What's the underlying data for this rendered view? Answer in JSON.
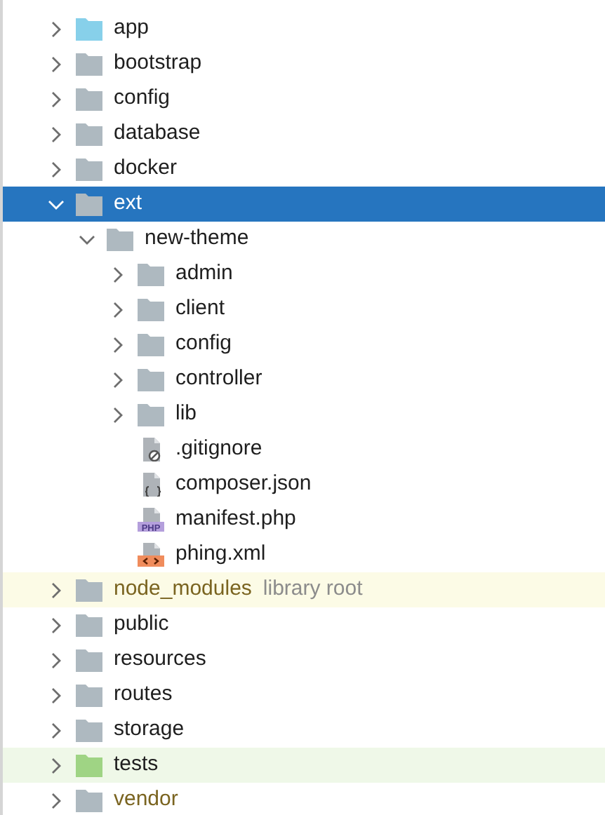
{
  "tree": [
    {
      "name": "app",
      "kind": "source_folder",
      "expanded": false,
      "selected": false
    },
    {
      "name": "bootstrap",
      "kind": "folder",
      "expanded": false,
      "selected": false
    },
    {
      "name": "config",
      "kind": "folder",
      "expanded": false,
      "selected": false
    },
    {
      "name": "database",
      "kind": "folder",
      "expanded": false,
      "selected": false
    },
    {
      "name": "docker",
      "kind": "folder",
      "expanded": false,
      "selected": false
    },
    {
      "name": "ext",
      "kind": "folder",
      "expanded": true,
      "selected": true,
      "children": [
        {
          "name": "new-theme",
          "kind": "folder",
          "expanded": true,
          "selected": false,
          "children": [
            {
              "name": "admin",
              "kind": "folder",
              "expanded": false,
              "selected": false
            },
            {
              "name": "client",
              "kind": "folder",
              "expanded": false,
              "selected": false
            },
            {
              "name": "config",
              "kind": "folder",
              "expanded": false,
              "selected": false
            },
            {
              "name": "controller",
              "kind": "folder",
              "expanded": false,
              "selected": false
            },
            {
              "name": "lib",
              "kind": "folder",
              "expanded": false,
              "selected": false
            },
            {
              "name": ".gitignore",
              "kind": "ignore_file",
              "selected": false
            },
            {
              "name": "composer.json",
              "kind": "json_file",
              "selected": false
            },
            {
              "name": "manifest.php",
              "kind": "php_file",
              "icon_label": "PHP",
              "selected": false
            },
            {
              "name": "phing.xml",
              "kind": "xml_file",
              "selected": false
            }
          ]
        }
      ]
    },
    {
      "name": "node_modules",
      "kind": "library_folder",
      "hint": "library root",
      "expanded": false,
      "selected": false
    },
    {
      "name": "public",
      "kind": "folder",
      "expanded": false,
      "selected": false
    },
    {
      "name": "resources",
      "kind": "folder",
      "expanded": false,
      "selected": false
    },
    {
      "name": "routes",
      "kind": "folder",
      "expanded": false,
      "selected": false
    },
    {
      "name": "storage",
      "kind": "folder",
      "expanded": false,
      "selected": false
    },
    {
      "name": "tests",
      "kind": "test_folder",
      "expanded": false,
      "selected": false
    },
    {
      "name": "vendor",
      "kind": "excluded_folder",
      "expanded": false,
      "selected": false
    }
  ]
}
